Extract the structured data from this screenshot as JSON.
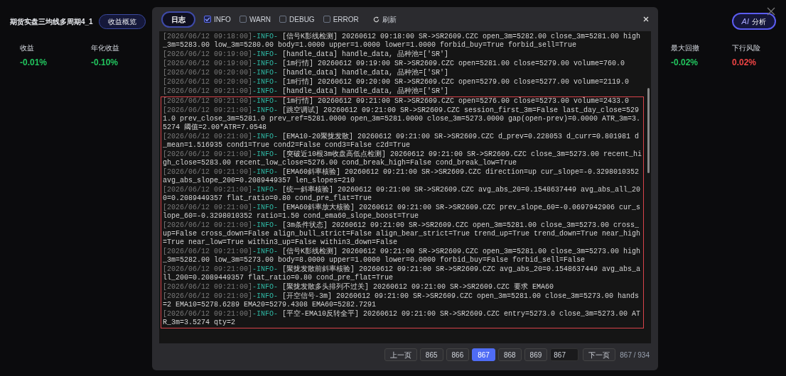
{
  "dashboard": {
    "title": "期货实盘三均线多周期4_1",
    "tab": "收益概览",
    "ai_button": {
      "icon_text": "AI",
      "label": "分析"
    },
    "metrics": [
      {
        "label": "收益",
        "value": "-0.01%",
        "color": "#22c55e"
      },
      {
        "label": "年化收益",
        "value": "-0.10%",
        "color": "#22c55e"
      },
      {
        "label": "最大回撤",
        "value": "-0.02%",
        "color": "#22c55e"
      },
      {
        "label": "下行风险",
        "value": "0.02%",
        "color": "#ef4444"
      }
    ]
  },
  "log_dialog": {
    "title": "日志",
    "filters": [
      {
        "label": "INFO",
        "checked": true
      },
      {
        "label": "WARN",
        "checked": false
      },
      {
        "label": "DEBUG",
        "checked": false
      },
      {
        "label": "ERROR",
        "checked": false
      }
    ],
    "refresh": "刷新",
    "entries": [
      {
        "time": "[2026/06/12 09:18:00]",
        "level": "-INFO-",
        "message": "[信号K影线检测] 20260612 09:18:00 SR->SR2609.CZC open_3m=5282.00 close_3m=5281.00 high_3m=5283.00 low_3m=5280.00 body=1.0000 upper=1.0000 lower=1.0000 forbid_buy=True forbid_sell=True"
      },
      {
        "time": "[2026/06/12 09:19:00]",
        "level": "-INFO-",
        "message": "[handle_data] handle_data, 品种池=['SR']"
      },
      {
        "time": "[2026/06/12 09:19:00]",
        "level": "-INFO-",
        "message": "[1m行情] 20260612 09:19:00 SR->SR2609.CZC open=5281.00 close=5279.00 volume=760.0"
      },
      {
        "time": "[2026/06/12 09:20:00]",
        "level": "-INFO-",
        "message": "[handle_data] handle_data, 品种池=['SR']"
      },
      {
        "time": "[2026/06/12 09:20:00]",
        "level": "-INFO-",
        "message": "[1m行情] 20260612 09:20:00 SR->SR2609.CZC open=5279.00 close=5277.00 volume=2119.0"
      },
      {
        "time": "[2026/06/12 09:21:00]",
        "level": "-INFO-",
        "message": "[handle_data] handle_data, 品种池=['SR']"
      }
    ],
    "highlighted_entries": [
      {
        "time": "[2026/06/12 09:21:00]",
        "level": "-INFO-",
        "message": "[1m行情] 20260612 09:21:00 SR->SR2609.CZC open=5276.00 close=5273.00 volume=2433.0"
      },
      {
        "time": "[2026/06/12 09:21:00]",
        "level": "-INFO-",
        "message": "[跳空调试] 20260612 09:21:00 SR->SR2609.CZC session_first_3m=False last_day_close=5291.0 prev_close_3m=5281.0 prev_ref=5281.0000 open_3m=5281.0000 close_3m=5273.0000 gap(open-prev)=0.0000 ATR_3m=3.5274 阈值=2.00*ATR=7.0548"
      },
      {
        "time": "[2026/06/12 09:21:00]",
        "level": "-INFO-",
        "message": "[EMA10-20聚拢发散] 20260612 09:21:00 SR->SR2609.CZC d_prev=0.228053 d_curr=0.801981 d_mean=1.516935 cond1=True cond2=False cond3=False c2d=True"
      },
      {
        "time": "[2026/06/12 09:21:00]",
        "level": "-INFO-",
        "message": "[突破近10根3m收盘高低点检测] 20260612 09:21:00 SR->SR2609.CZC close_3m=5273.00 recent_high_close=5283.00 recent_low_close=5276.00 cond_break_high=False cond_break_low=True"
      },
      {
        "time": "[2026/06/12 09:21:00]",
        "level": "-INFO-",
        "message": "[EMA60斜率核验] 20260612 09:21:00 SR->SR2609.CZC direction=up cur_slope=-0.3298010352 avg_abs_slope_200=0.2089449357 len_slopes=210"
      },
      {
        "time": "[2026/06/12 09:21:00]",
        "level": "-INFO-",
        "message": "[统一斜率核验] 20260612 09:21:00 SR->SR2609.CZC avg_abs_20=0.1548637449 avg_abs_all_200=0.2089449357 flat_ratio=0.80 cond_pre_flat=True"
      },
      {
        "time": "[2026/06/12 09:21:00]",
        "level": "-INFO-",
        "message": "[EMA60斜率放大核验] 20260612 09:21:00 SR->SR2609.CZC prev_slope_60=-0.0697942906 cur_slope_60=-0.3298010352 ratio=1.50 cond_ema60_slope_boost=True"
      },
      {
        "time": "[2026/06/12 09:21:00]",
        "level": "-INFO-",
        "message": "[3m条件状态] 20260612 09:21:00 SR->SR2609.CZC open_3m=5281.00 close_3m=5273.00 cross_up=False cross_down=False align_bull_strict=False align_bear_strict=True trend_up=True trend_down=True near_high=True near_low=True within3_up=False within3_down=False"
      },
      {
        "time": "[2026/06/12 09:21:00]",
        "level": "-INFO-",
        "message": "[信号K影线检测] 20260612 09:21:00 SR->SR2609.CZC open_3m=5281.00 close_3m=5273.00 high_3m=5282.00 low_3m=5273.00 body=8.0000 upper=1.0000 lower=0.0000 forbid_buy=False forbid_sell=False"
      },
      {
        "time": "[2026/06/12 09:21:00]",
        "level": "-INFO-",
        "message": "[聚拢发散前斜率核验] 20260612 09:21:00 SR->SR2609.CZC avg_abs_20=0.1548637449 avg_abs_all_200=0.2089449357 flat_ratio=0.80 cond_pre_flat=True"
      },
      {
        "time": "[2026/06/12 09:21:00]",
        "level": "-INFO-",
        "message": "[聚拢发散多头排列不过关] 20260612 09:21:00 SR->SR2609.CZC 要求 EMA60"
      },
      {
        "time": "[2026/06/12 09:21:00]",
        "level": "-INFO-",
        "message": "[开空信号-3m] 20260612 09:21:00 SR->SR2609.CZC open_3m=5281.00 close_3m=5273.00 hands=2 EMA10=5278.6289 EMA20=5279.4308 EMA60=5282.7291"
      },
      {
        "time": "[2026/06/12 09:21:00]",
        "level": "-INFO-",
        "message": "[平空-EMA10反转全平] 20260612 09:21:00 SR->SR2609.CZC entry=5273.0 close_3m=5273.00 ATR_3m=3.5274 qty=2"
      }
    ],
    "pagination": {
      "prev": "上一页",
      "pages": [
        {
          "label": "865",
          "selected": false
        },
        {
          "label": "866",
          "selected": false
        },
        {
          "label": "867",
          "selected": true
        },
        {
          "label": "868",
          "selected": false
        },
        {
          "label": "869",
          "selected": false
        }
      ],
      "jump_value": "867",
      "next": "下一页",
      "count": "867 / 934"
    }
  }
}
